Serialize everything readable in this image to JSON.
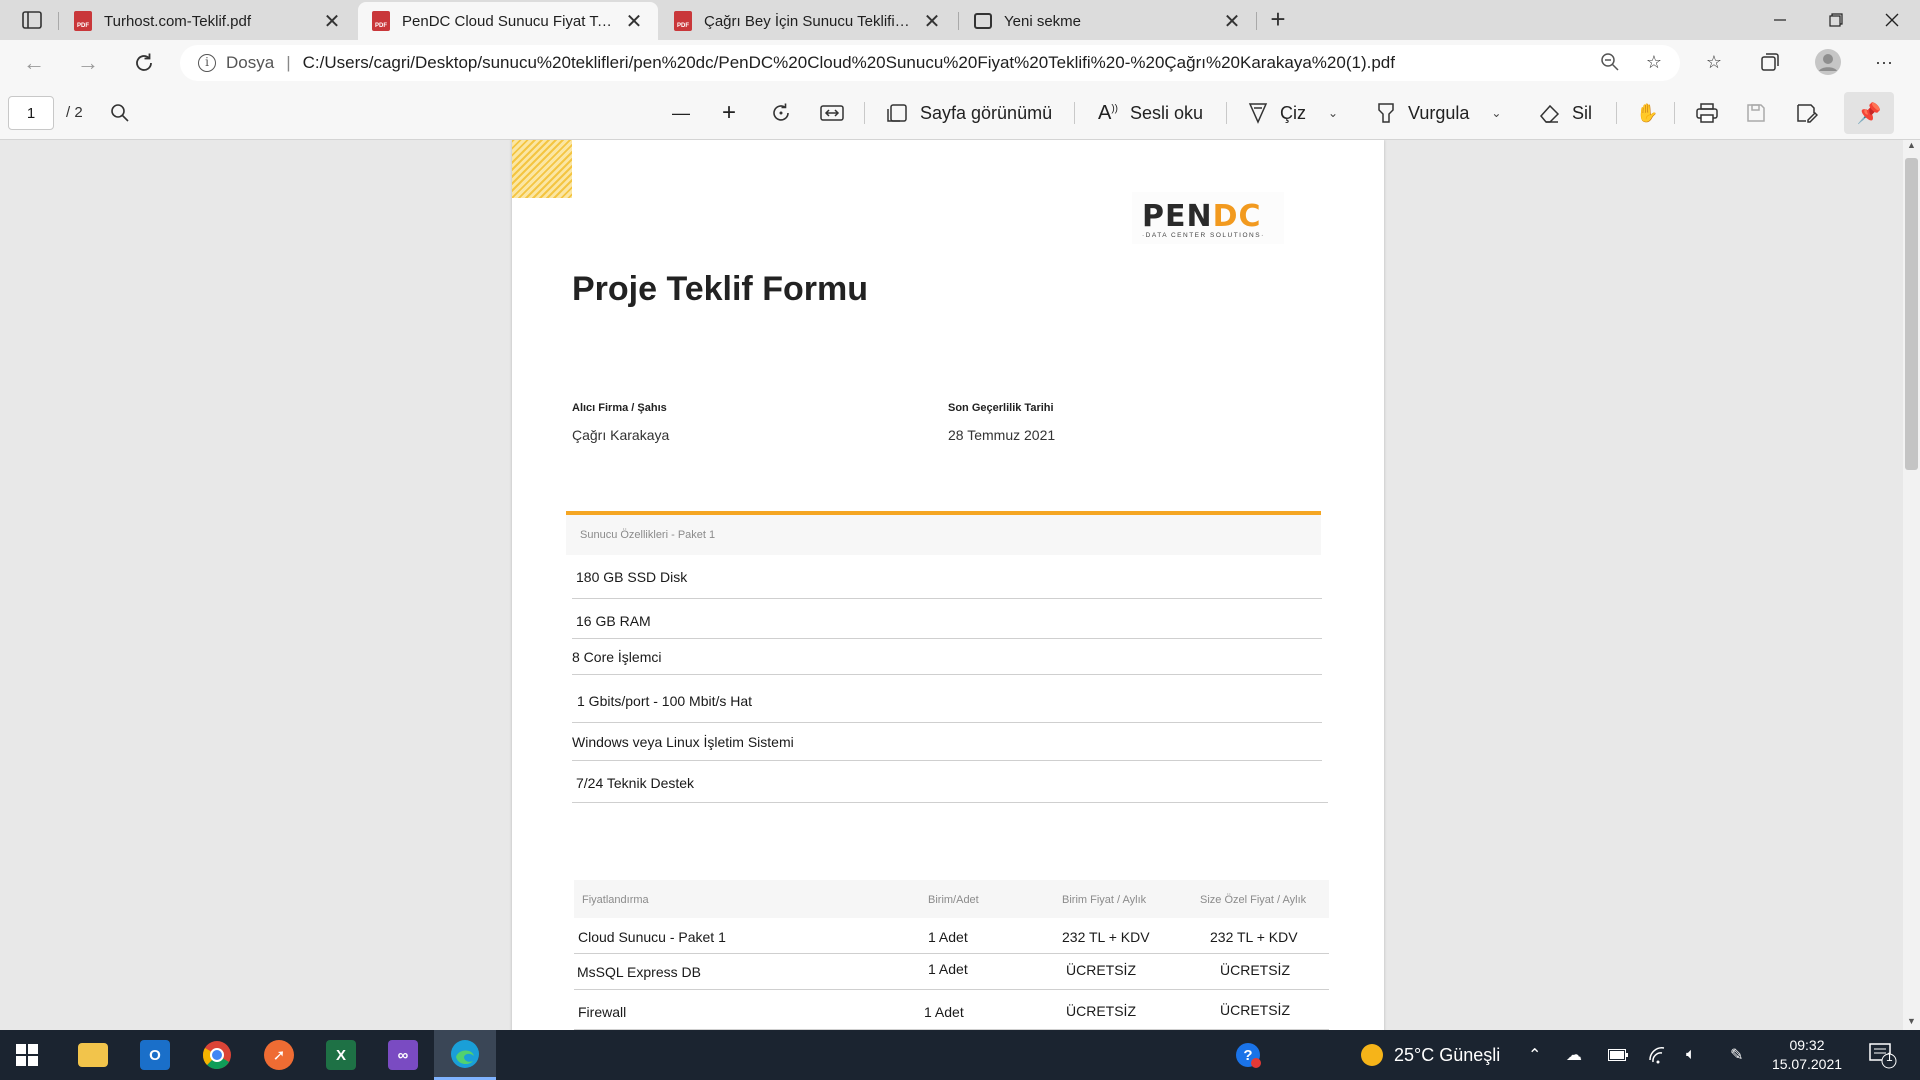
{
  "tabs": [
    {
      "title": "Turhost.com-Teklif.pdf",
      "favicon": "pdf-icon",
      "active": false
    },
    {
      "title": "PenDC Cloud Sunucu Fiyat Teklifi",
      "favicon": "pdf-icon",
      "active": true
    },
    {
      "title": "Çağrı Bey İçin Sunucu Teklifimiz",
      "favicon": "pdf-icon",
      "active": false
    },
    {
      "title": "Yeni sekme",
      "favicon": "new-tab-page-icon",
      "active": false
    }
  ],
  "favicon_text": "PDF",
  "address": {
    "scheme_label": "Dosya",
    "divider": "|",
    "url": "C:/Users/cagri/Desktop/sunucu%20teklifleri/pen%20dc/PenDC%20Cloud%20Sunucu%20Fiyat%20Teklifi%20-%20Çağrı%20Karakaya%20(1).pdf"
  },
  "pdf_toolbar": {
    "page_current": "1",
    "page_total": "/ 2",
    "page_view": "Sayfa görünümü",
    "read_aloud": "Sesli oku",
    "draw": "Çiz",
    "highlight": "Vurgula",
    "erase": "Sil"
  },
  "document": {
    "logo": {
      "pen": "PEN",
      "dc": "DC",
      "tagline": "·DATA CENTER SOLUTIONS·"
    },
    "title": "Proje Teklif Formu",
    "recipient_label": "Alıcı Firma / Şahıs",
    "recipient_value": "Çağrı Karakaya",
    "valid_until_label": "Son Geçerlilik Tarihi",
    "valid_until_value": "28 Temmuz 2021",
    "specs_header": "Sunucu  Özellikleri - Paket 1",
    "specs": [
      "180 GB  SSD  Disk",
      "16 GB RAM",
      "8  Core İşlemci",
      "1 Gbits/port - 100 Mbit/s Hat",
      "Windows veya Linux İşletim Sistemi",
      "7/24 Teknik Destek"
    ],
    "pricing_header": {
      "item": "Fiyatlandırma",
      "unit": "Birim/Adet",
      "unit_price": "Birim Fiyat / Aylık",
      "special_price": "Size Özel Fiyat / Aylık"
    },
    "pricing_rows": [
      {
        "item": "Cloud Sunucu - Paket 1",
        "unit": "1 Adet",
        "unit_price": "232 TL + KDV",
        "special_price": "232 TL + KDV"
      },
      {
        "item": "MsSQL Express DB",
        "unit": "1 Adet",
        "unit_price": "ÜCRETSİZ",
        "special_price": "ÜCRETSİZ"
      },
      {
        "item": "Firewall",
        "unit": "1 Adet",
        "unit_price": "ÜCRETSİZ",
        "special_price": "ÜCRETSİZ"
      }
    ]
  },
  "taskbar": {
    "apps": [
      "file-explorer",
      "outlook",
      "chrome",
      "postman",
      "excel",
      "visual-studio",
      "edge"
    ],
    "weather": "25°C  Güneşli",
    "time": "09:32",
    "date": "15.07.2021",
    "notification_count": "1"
  },
  "colors": {
    "accent": "#f5a623",
    "brand_orange": "#f29a1f",
    "taskbar": "#1b2430"
  }
}
